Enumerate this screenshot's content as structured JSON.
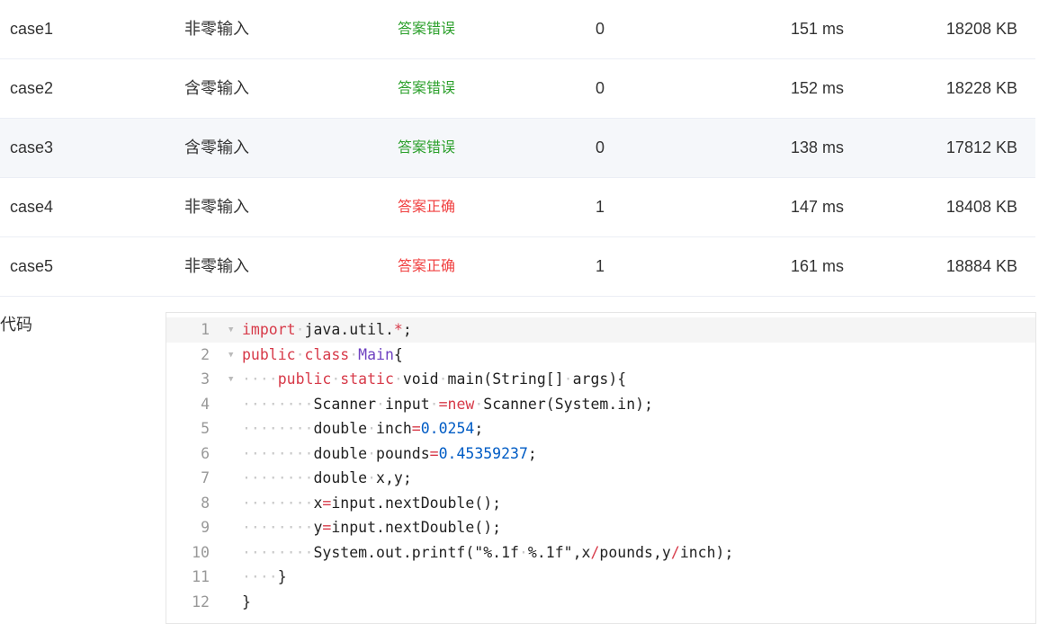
{
  "results": [
    {
      "name": "case1",
      "type": "非零输入",
      "result": "答案错误",
      "result_status": "wrong",
      "score": "0",
      "time": "151 ms",
      "memory": "18208 KB"
    },
    {
      "name": "case2",
      "type": "含零输入",
      "result": "答案错误",
      "result_status": "wrong",
      "score": "0",
      "time": "152 ms",
      "memory": "18228 KB"
    },
    {
      "name": "case3",
      "type": "含零输入",
      "result": "答案错误",
      "result_status": "wrong",
      "score": "0",
      "time": "138 ms",
      "memory": "17812 KB"
    },
    {
      "name": "case4",
      "type": "非零输入",
      "result": "答案正确",
      "result_status": "correct",
      "score": "1",
      "time": "147 ms",
      "memory": "18408 KB"
    },
    {
      "name": "case5",
      "type": "非零输入",
      "result": "答案正确",
      "result_status": "correct",
      "score": "1",
      "time": "161 ms",
      "memory": "18884 KB"
    }
  ],
  "code_section": {
    "label": "代码",
    "lines": [
      {
        "n": "1",
        "fold": true,
        "text": "import java.util.*;"
      },
      {
        "n": "2",
        "fold": true,
        "text": "public class Main{"
      },
      {
        "n": "3",
        "fold": true,
        "text": "    public static void main(String[] args){"
      },
      {
        "n": "4",
        "fold": false,
        "text": "        Scanner input =new Scanner(System.in);"
      },
      {
        "n": "5",
        "fold": false,
        "text": "        double inch=0.0254;"
      },
      {
        "n": "6",
        "fold": false,
        "text": "        double pounds=0.45359237;"
      },
      {
        "n": "7",
        "fold": false,
        "text": "        double x,y;"
      },
      {
        "n": "8",
        "fold": false,
        "text": "        x=input.nextDouble();"
      },
      {
        "n": "9",
        "fold": false,
        "text": "        y=input.nextDouble();"
      },
      {
        "n": "10",
        "fold": false,
        "text": "        System.out.printf(\"%.1f %.1f\",x/pounds,y/inch);"
      },
      {
        "n": "11",
        "fold": false,
        "text": "    }"
      },
      {
        "n": "12",
        "fold": false,
        "text": "}"
      }
    ]
  },
  "colors": {
    "wrong": "#2ca02c",
    "correct": "#f04040",
    "keyword": "#d73a49",
    "class_name": "#6f42c1",
    "number": "#005cc5"
  }
}
